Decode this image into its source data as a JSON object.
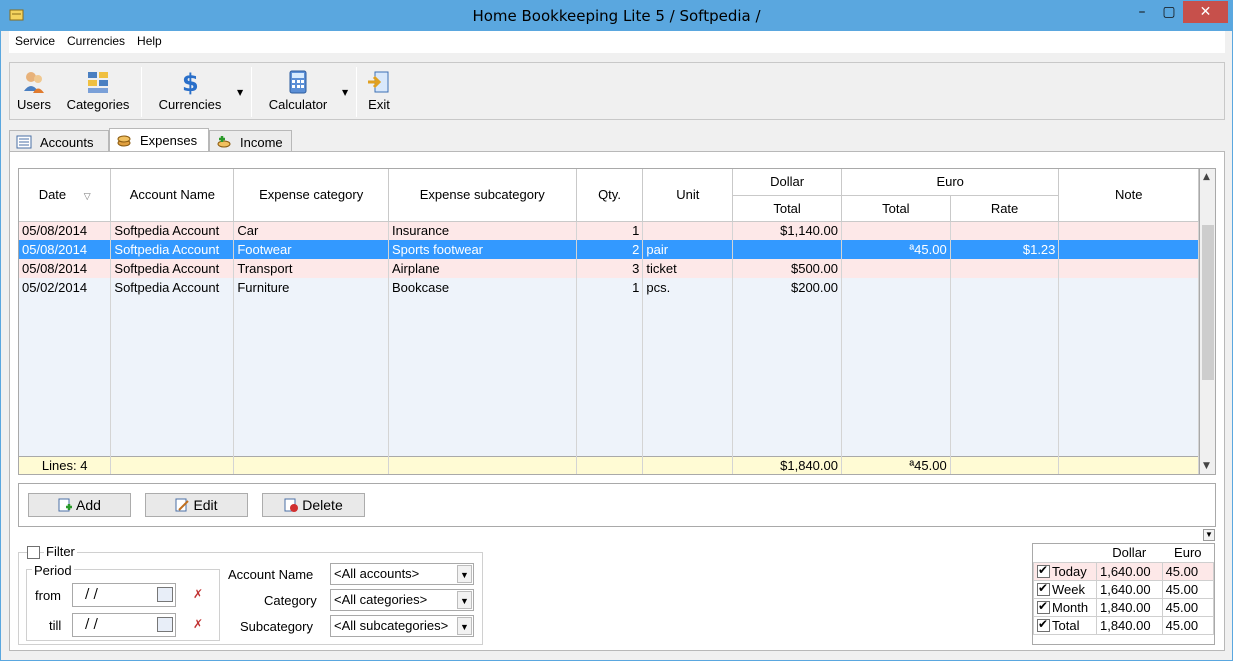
{
  "window": {
    "title": "Home Bookkeeping Lite 5  / Softpedia /",
    "minimize": "–",
    "maximize": "▢",
    "close": "✕"
  },
  "menu": [
    "Service",
    "Currencies",
    "Help"
  ],
  "toolbar": {
    "users": "Users",
    "categories": "Categories",
    "currencies": "Currencies",
    "calculator": "Calculator",
    "exit": "Exit"
  },
  "tabs": [
    {
      "label": "Accounts"
    },
    {
      "label": "Expenses"
    },
    {
      "label": "Income"
    }
  ],
  "table": {
    "headers": {
      "date": "Date",
      "account": "Account Name",
      "category": "Expense category",
      "subcategory": "Expense subcategory",
      "qty": "Qty.",
      "unit": "Unit",
      "dollar": "Dollar",
      "dollar_total": "Total",
      "euro": "Euro",
      "euro_total": "Total",
      "euro_rate": "Rate",
      "note": "Note"
    },
    "rows": [
      {
        "date": "05/08/2014",
        "account": "Softpedia Account",
        "category": "Car",
        "subcategory": "Insurance",
        "qty": "1",
        "unit": "",
        "dollar_total": "$1,140.00",
        "euro_total": "",
        "rate": "",
        "note": ""
      },
      {
        "date": "05/08/2014",
        "account": "Softpedia Account",
        "category": "Footwear",
        "subcategory": "Sports footwear",
        "qty": "2",
        "unit": "pair",
        "dollar_total": "",
        "euro_total": "ª45.00",
        "rate": "$1.23",
        "note": ""
      },
      {
        "date": "05/08/2014",
        "account": "Softpedia Account",
        "category": "Transport",
        "subcategory": "Airplane",
        "qty": "3",
        "unit": "ticket",
        "dollar_total": "$500.00",
        "euro_total": "",
        "rate": "",
        "note": ""
      },
      {
        "date": "05/02/2014",
        "account": "Softpedia Account",
        "category": "Furniture",
        "subcategory": "Bookcase",
        "qty": "1",
        "unit": "pcs.",
        "dollar_total": "$200.00",
        "euro_total": "",
        "rate": "",
        "note": ""
      }
    ],
    "footer": {
      "lines": "Lines: 4",
      "dollar_total": "$1,840.00",
      "euro_total": "ª45.00"
    }
  },
  "buttons": {
    "add": "Add",
    "edit": "Edit",
    "delete": "Delete"
  },
  "filter": {
    "label": "Filter",
    "period": "Period",
    "from": "from",
    "till": "till",
    "from_value": "/  /",
    "till_value": "/  /",
    "account_label": "Account Name",
    "account_value": "<All accounts>",
    "category_label": "Category",
    "category_value": "<All categories>",
    "subcategory_label": "Subcategory",
    "subcategory_value": "<All subcategories>"
  },
  "summary": {
    "headers": [
      "Dollar",
      "Euro"
    ],
    "rows": [
      {
        "label": "Today",
        "dollar": "1,640.00",
        "euro": "45.00"
      },
      {
        "label": "Week",
        "dollar": "1,640.00",
        "euro": "45.00"
      },
      {
        "label": "Month",
        "dollar": "1,840.00",
        "euro": "45.00"
      },
      {
        "label": "Total",
        "dollar": "1,840.00",
        "euro": "45.00"
      }
    ]
  },
  "colors": {
    "titlebar": "#5aa7df",
    "selection": "#3399ff",
    "pink_row": "#fde8e8",
    "footer_row": "#fffbd4"
  }
}
